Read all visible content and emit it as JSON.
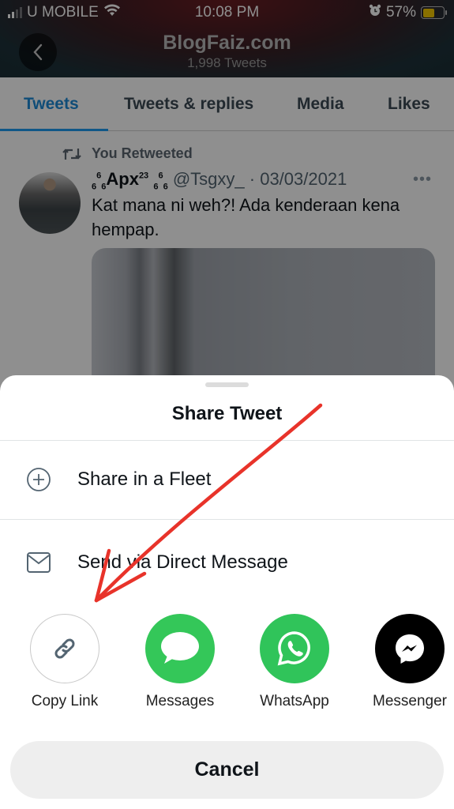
{
  "status_bar": {
    "carrier": "U MOBILE",
    "time": "10:08 PM",
    "battery_percent_label": "57%",
    "battery_level": 0.57,
    "battery_color": "#f5c800"
  },
  "profile_header": {
    "name": "BlogFaiz.com",
    "tweet_count": "1,998 Tweets"
  },
  "tabs": [
    {
      "label": "Tweets",
      "active": true
    },
    {
      "label": "Tweets & replies",
      "active": false
    },
    {
      "label": "Media",
      "active": false
    },
    {
      "label": "Likes",
      "active": false
    }
  ],
  "tweet": {
    "retweet_context": "You Retweeted",
    "author_prefix_sup": "6",
    "author_prefix_sub": "6",
    "author_pre": "6",
    "author_name": "Apx",
    "author_sup": "23",
    "author_suffix_a": "6",
    "author_suffix_sup": "6",
    "author_suffix_b": "6",
    "handle": "@Tsgxy_",
    "separator": "·",
    "date": "03/03/2021",
    "text": "Kat mana ni weh?! Ada kenderaan kena hempap.",
    "more_label": "•••"
  },
  "share_sheet": {
    "title": "Share Tweet",
    "options": [
      {
        "label": "Share in a Fleet",
        "icon": "plus-circle-icon"
      },
      {
        "label": "Send via Direct Message",
        "icon": "envelope-icon"
      }
    ],
    "targets": [
      {
        "label": "Copy Link",
        "icon": "link-icon",
        "color": "#ffffff"
      },
      {
        "label": "Messages",
        "icon": "speech-bubble-icon",
        "color": "#34c759"
      },
      {
        "label": "WhatsApp",
        "icon": "whatsapp-icon",
        "color": "#30c45a"
      },
      {
        "label": "Messenger",
        "icon": "messenger-icon",
        "color": "#000000"
      }
    ],
    "cancel_label": "Cancel"
  },
  "annotation": {
    "arrow_color": "#e8332a",
    "target": "Copy Link"
  }
}
